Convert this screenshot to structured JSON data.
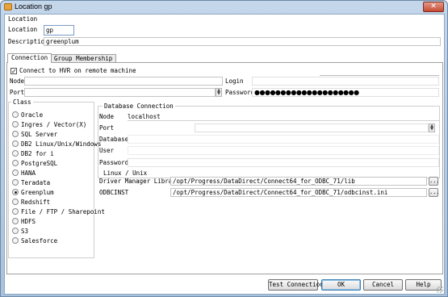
{
  "window": {
    "title": "Location gp",
    "close_label": "✕"
  },
  "location_group": {
    "title": "Location",
    "location_label": "Location",
    "location_value": "gp",
    "description_label": "Description",
    "description_value": "greenplum"
  },
  "tabs": [
    {
      "label": "Connection"
    },
    {
      "label": "Group Membership"
    }
  ],
  "connection": {
    "hvr_label": "Connect to HVR on remote machine",
    "hvr_checked": true,
    "node_label": "Node",
    "node_value": "",
    "port_label": "Port",
    "port_value": "",
    "login_label": "Login",
    "login_value": "",
    "password_label": "Password",
    "password_value": "●●●●●●●●●●●●●●●●●●●●"
  },
  "class_group": {
    "title": "Class",
    "items": [
      {
        "label": "Oracle",
        "selected": false
      },
      {
        "label": "Ingres / Vector(X)",
        "selected": false
      },
      {
        "label": "SQL Server",
        "selected": false
      },
      {
        "label": "DB2 Linux/Unix/Windows",
        "selected": false
      },
      {
        "label": "DB2 for i",
        "selected": false
      },
      {
        "label": "PostgreSQL",
        "selected": false
      },
      {
        "label": "HANA",
        "selected": false
      },
      {
        "label": "Teradata",
        "selected": false
      },
      {
        "label": "Greenplum",
        "selected": true
      },
      {
        "label": "Redshift",
        "selected": false
      },
      {
        "label": "File / FTP / Sharepoint",
        "selected": false
      },
      {
        "label": "HDFS",
        "selected": false
      },
      {
        "label": "S3",
        "selected": false
      },
      {
        "label": "Salesforce",
        "selected": false
      }
    ]
  },
  "db_connection": {
    "title": "Database Connection",
    "node_label": "Node",
    "node_value": "localhost",
    "port_label": "Port",
    "port_value": "",
    "database_label": "Database",
    "database_value": "",
    "user_label": "User",
    "user_value": "",
    "password_label": "Password",
    "password_value": ""
  },
  "linux_unix": {
    "title": "Linux / Unix",
    "dml_label": "Driver Manager Library",
    "dml_value": "/opt/Progress/DataDirect/Connect64_for_ODBC_71/lib",
    "odbcinst_label": "ODBCINST",
    "odbcinst_value": "/opt/Progress/DataDirect/Connect64_for_ODBC_71/odbcinst.ini",
    "browse_label": "..."
  },
  "buttons": {
    "test_connection": "Test Connection",
    "ok": "OK",
    "cancel": "Cancel",
    "help": "Help"
  }
}
